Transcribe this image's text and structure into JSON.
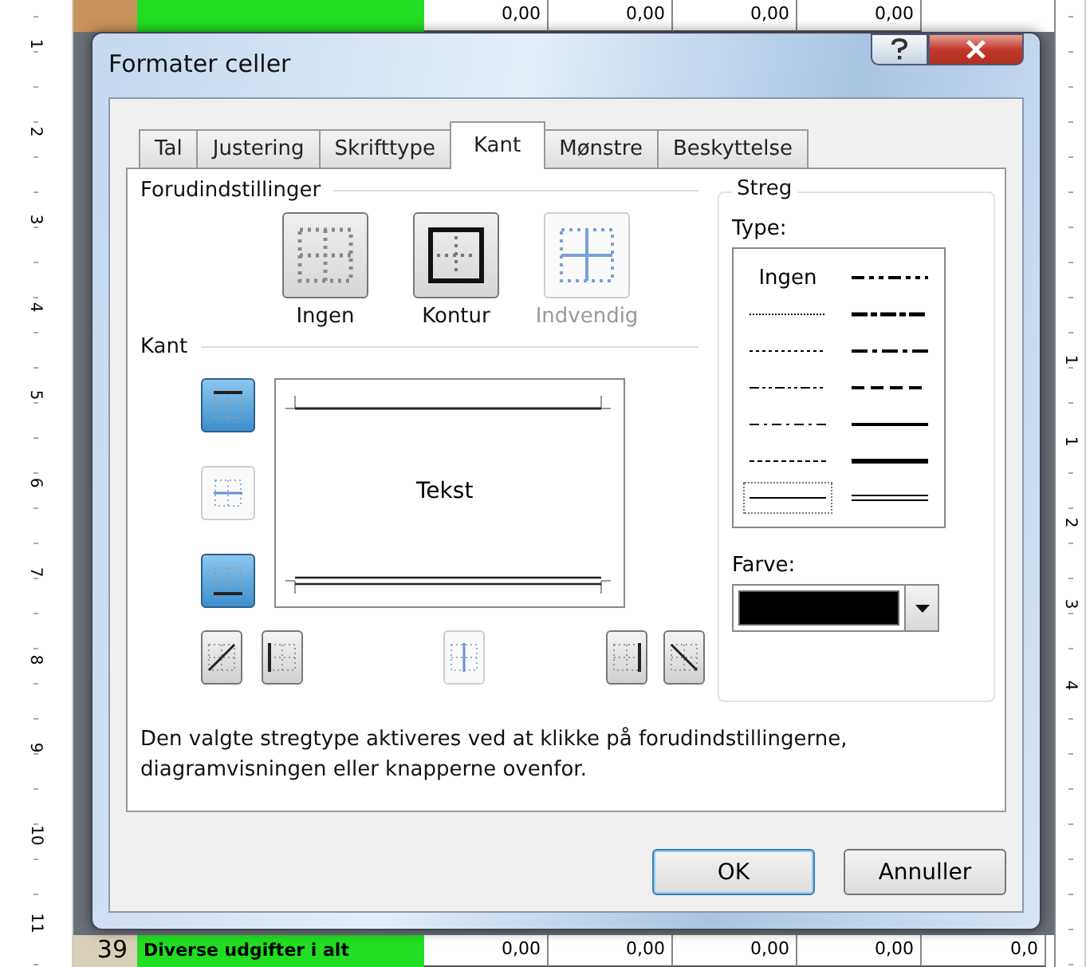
{
  "sheet": {
    "top_values": [
      "0,00",
      "0,00",
      "0,00",
      "0,00"
    ],
    "bottom_row": {
      "number": "39",
      "label": "Diverse udgifter i alt",
      "values": [
        "0,00",
        "0,00",
        "0,00",
        "0,00",
        "0,0"
      ]
    },
    "left_ruler": [
      "1",
      "2",
      "3",
      "4",
      "5",
      "6",
      "7",
      "8",
      "9",
      "10",
      "11"
    ],
    "right_ruler": [
      "1",
      "1",
      "2",
      "3",
      "4"
    ]
  },
  "window": {
    "title": "Formater celler"
  },
  "tabs": [
    {
      "label": "Tal",
      "selected": false
    },
    {
      "label": "Justering",
      "selected": false
    },
    {
      "label": "Skrifttype",
      "selected": false
    },
    {
      "label": "Kant",
      "selected": true
    },
    {
      "label": "Mønstre",
      "selected": false
    },
    {
      "label": "Beskyttelse",
      "selected": false
    }
  ],
  "presets": {
    "heading": "Forudindstillinger",
    "items": [
      {
        "kind": "none",
        "label": "Ingen",
        "disabled": false
      },
      {
        "kind": "outline",
        "label": "Kontur",
        "disabled": false
      },
      {
        "kind": "inside",
        "label": "Indvendig",
        "disabled": true
      }
    ]
  },
  "border": {
    "heading": "Kant",
    "preview_text": "Tekst",
    "side_buttons": [
      {
        "kind": "top",
        "pressed": true,
        "disabled": false
      },
      {
        "kind": "middle",
        "pressed": false,
        "disabled": true
      },
      {
        "kind": "bottom",
        "pressed": true,
        "disabled": false
      }
    ],
    "bottom_buttons": [
      {
        "kind": "diagup",
        "pressed": false,
        "disabled": false
      },
      {
        "kind": "left",
        "pressed": false,
        "disabled": false
      },
      {
        "kind": "center",
        "pressed": false,
        "disabled": true
      },
      {
        "kind": "right",
        "pressed": false,
        "disabled": false
      },
      {
        "kind": "diagdown",
        "pressed": false,
        "disabled": false
      }
    ]
  },
  "line": {
    "heading": "Streg",
    "type_label": "Type:",
    "styles": [
      {
        "kind": "none",
        "label": "Ingen",
        "selected": false
      },
      {
        "kind": "mediumdashdotdot",
        "selected": false
      },
      {
        "kind": "hair",
        "selected": false
      },
      {
        "kind": "slantdashdot",
        "selected": false
      },
      {
        "kind": "dotted",
        "selected": false
      },
      {
        "kind": "mediumdashdot",
        "selected": false
      },
      {
        "kind": "dashdotdot",
        "selected": false
      },
      {
        "kind": "mediumdashed",
        "selected": false
      },
      {
        "kind": "dashdot",
        "selected": false
      },
      {
        "kind": "medium",
        "selected": false
      },
      {
        "kind": "dashed",
        "selected": false
      },
      {
        "kind": "thick",
        "selected": false
      },
      {
        "kind": "thin",
        "selected": true
      },
      {
        "kind": "double",
        "selected": false
      }
    ],
    "color_label": "Farve:",
    "color": "#000000"
  },
  "help_text": "Den valgte stregtype aktiveres ved at klikke på forudindstillingerne, diagramvisningen eller knapperne ovenfor.",
  "buttons": [
    {
      "label": "OK",
      "default": true
    },
    {
      "label": "Annuller",
      "default": false
    }
  ]
}
